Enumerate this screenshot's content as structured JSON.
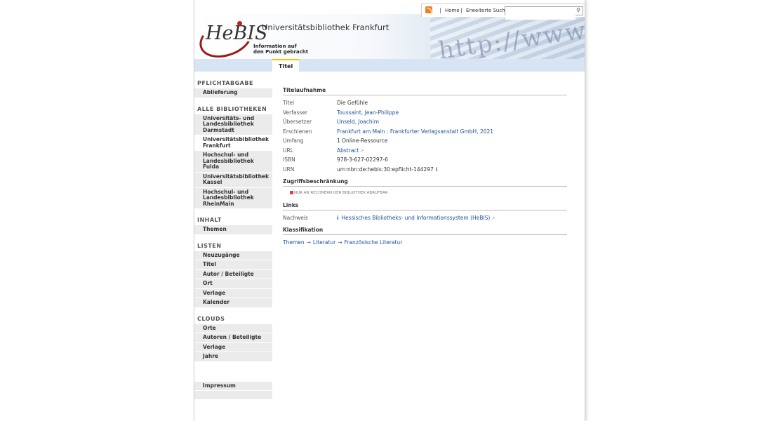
{
  "topbar": {
    "icon": "rss-icon",
    "home": "Home",
    "advanced_search": "Erweiterte Suche",
    "search_placeholder": ""
  },
  "header": {
    "logo_text": "HeBIS",
    "tagline": "Information auf\nden Punkt gebracht",
    "title": "Universitätsbibliothek Frankfurt",
    "deco_text": "http://www"
  },
  "tabs": [
    {
      "label": "Titel"
    }
  ],
  "sidebar": {
    "pflicht": {
      "heading": "PFLICHTABGABE",
      "items": [
        "Ablieferung"
      ]
    },
    "bibliotheken": {
      "heading": "ALLE BIBLIOTHEKEN",
      "items": [
        "Universitäts- und Landesbibliothek Darmstadt",
        "Universitätsbibliothek Frankfurt",
        "Hochschul- und Landesbibliothek Fulda",
        "Universitätsbibliothek Kassel",
        "Hochschul- und Landesbibliothek RheinMain"
      ]
    },
    "inhalt": {
      "heading": "INHALT",
      "items": [
        "Themen"
      ]
    },
    "listen": {
      "heading": "LISTEN",
      "items": [
        "Neuzugänge",
        "Titel",
        "Autor / Beteiligte",
        "Ort",
        "Verlage",
        "Kalender"
      ]
    },
    "clouds": {
      "heading": "CLOUDS",
      "items": [
        "Orte",
        "Autoren / Beteiligte",
        "Verlage",
        "Jahre"
      ]
    },
    "impressum": "Impressum"
  },
  "record": {
    "section_title": "Titelaufnahme",
    "fields": {
      "titel": {
        "label": "Titel",
        "value": "Die Gefühle"
      },
      "verfasser": {
        "label": "Verfasser",
        "value": "Toussaint, Jean-Philippe"
      },
      "uebersetzer": {
        "label": "Übersetzer",
        "value": "Unseld, Joachim"
      },
      "erschienen": {
        "label": "Erschienen",
        "value": "Frankfurt am Main : Frankfurter Verlagsanstalt GmbH, 2021"
      },
      "umfang": {
        "label": "Umfang",
        "value": "1 Online-Ressource"
      },
      "url": {
        "label": "URL",
        "value": "Abstract"
      },
      "isbn": {
        "label": "ISBN",
        "value": "978-3-627-02297-6"
      },
      "urn": {
        "label": "URN",
        "value": "urn:nbn:de:hebis:30:epflicht-144297"
      }
    }
  },
  "access": {
    "section_title": "Zugriffsbeschränkung",
    "text": "NUR AN RECHNERN DER BIBLIOTHEK ABRUFBAR",
    "color": "#e04050"
  },
  "links": {
    "section_title": "Links",
    "label": "Nachweis",
    "value": "Hessisches Bibliotheks- und Informationssystem (HeBIS)"
  },
  "classification": {
    "section_title": "Klassifikation",
    "path": [
      "Themen",
      "Literatur",
      "Französische Literatur"
    ],
    "separator": "→"
  },
  "colors": {
    "link": "#1d4f9a",
    "tabbar": "#d6e4f3",
    "accent": "#a01818",
    "tab_highlight": "#f4c200"
  }
}
